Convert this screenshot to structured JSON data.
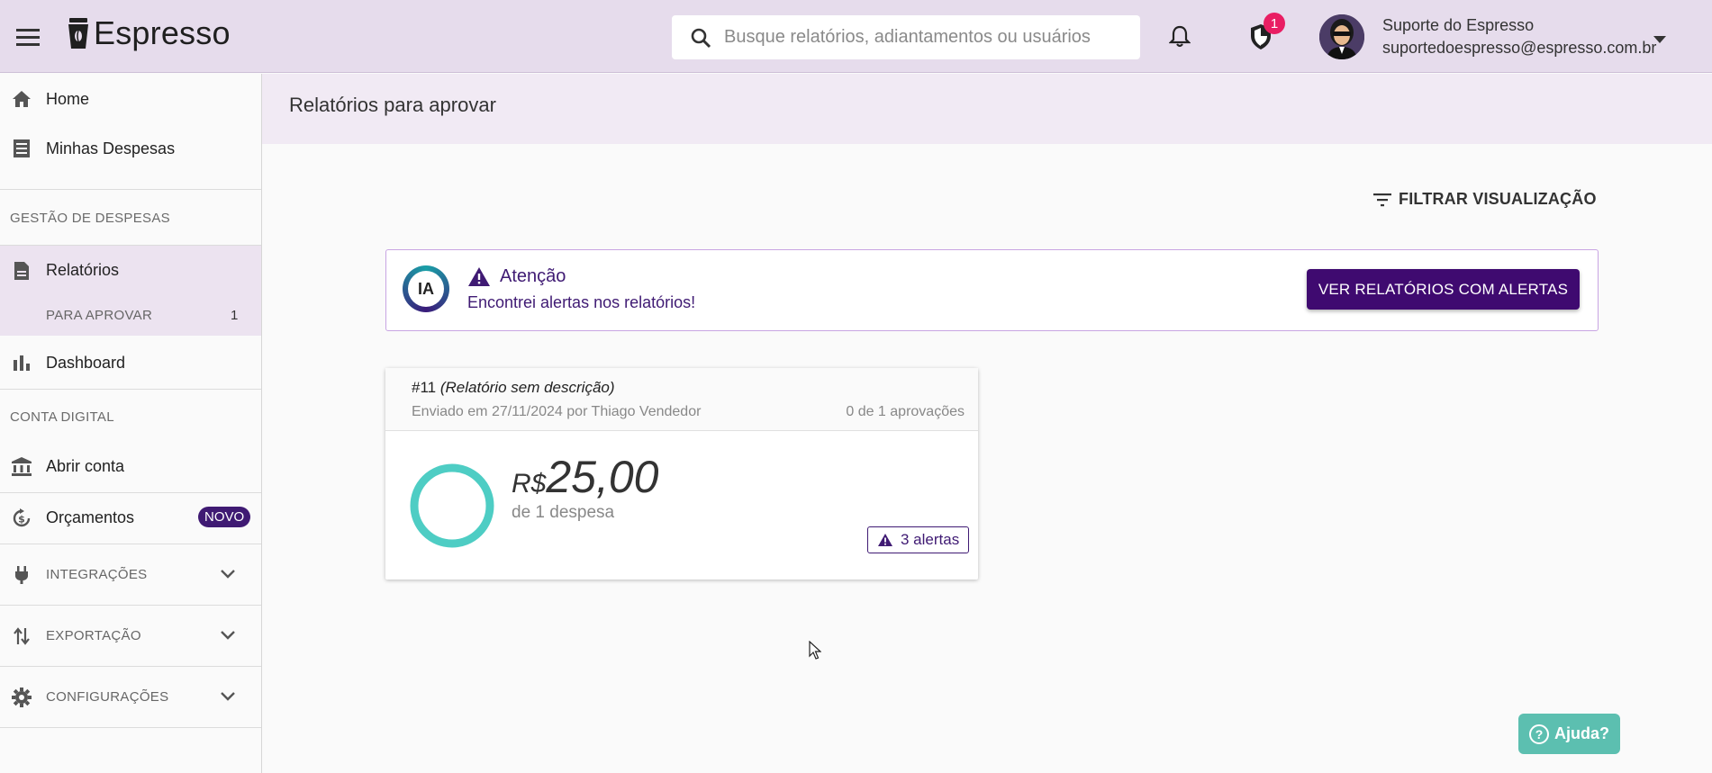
{
  "app": {
    "name": "Espresso"
  },
  "header": {
    "search_placeholder": "Busque relatórios, adiantamentos ou usuários",
    "shield_badge": "1",
    "user": {
      "name": "Suporte do Espresso",
      "email": "suportedoespresso@espresso.com.br"
    }
  },
  "sidebar": {
    "home": "Home",
    "minhas_despesas": "Minhas Despesas",
    "section_gestao": "GESTÃO DE DESPESAS",
    "relatorios": "Relatórios",
    "para_aprovar": "PARA APROVAR",
    "para_aprovar_count": "1",
    "dashboard": "Dashboard",
    "section_conta": "CONTA DIGITAL",
    "abrir_conta": "Abrir conta",
    "orcamentos": "Orçamentos",
    "novo_badge": "NOVO",
    "integracoes": "INTEGRAÇÕES",
    "exportacao": "EXPORTAÇÃO",
    "configuracoes": "CONFIGURAÇÕES"
  },
  "main": {
    "title": "Relatórios para aprovar",
    "filter_label": "FILTRAR VISUALIZAÇÃO",
    "alert": {
      "ia_label": "IA",
      "title": "Atenção",
      "text": "Encontrei alertas nos relatórios!",
      "button": "VER RELATÓRIOS COM ALERTAS"
    },
    "report": {
      "number": "#11",
      "description": "(Relatório sem descrição)",
      "sent_info": "Enviado em 27/11/2024 por Thiago Vendedor",
      "approvals": "0 de 1 aprovações",
      "currency": "R$",
      "amount": "25,00",
      "expenses": "de 1 despesa",
      "alerts": "3 alertas"
    }
  },
  "help": {
    "label": "Ajuda?"
  },
  "colors": {
    "header_bg": "#e6dcec",
    "brand_purple": "#3f0a70",
    "teal": "#4ecdc4",
    "help_bg": "#5cbfb0"
  }
}
